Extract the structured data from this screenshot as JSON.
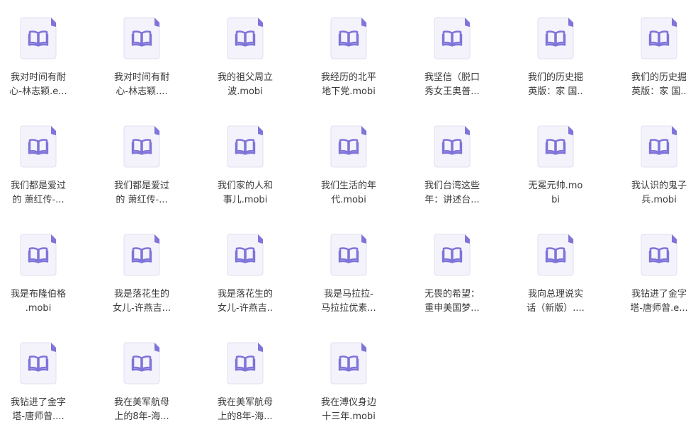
{
  "icons": {
    "file": "ebook-file-icon",
    "book": "open-book-icon"
  },
  "colors": {
    "accent": "#7f74d9",
    "page": "#f4f3fb",
    "border": "#e1dff2",
    "text": "#3a3a3a"
  },
  "files": [
    {
      "line1": "我对时间有耐",
      "line2": "心-林志颖.e..."
    },
    {
      "line1": "我对时间有耐",
      "line2": "心-林志颖...."
    },
    {
      "line1": "我的祖父周立",
      "line2": "波.mobi"
    },
    {
      "line1": "我经历的北平",
      "line2": "地下党.mobi"
    },
    {
      "line1": "我坚信（脱口",
      "line2": "秀女王奥普..."
    },
    {
      "line1": "我们的历史掘",
      "line2": "英版：家 国.."
    },
    {
      "line1": "我们的历史掘",
      "line2": "英版：家 国.."
    },
    {
      "line1": "我们都是爱过",
      "line2": "的 萧红传-..."
    },
    {
      "line1": "我们都是爱过",
      "line2": "的 萧红传-..."
    },
    {
      "line1": "我们家的人和",
      "line2": "事儿.mobi"
    },
    {
      "line1": "我们生活的年",
      "line2": "代.mobi"
    },
    {
      "line1": "我们台湾这些",
      "line2": "年：讲述台..."
    },
    {
      "line1": "无冕元帅.mo",
      "line2": "bi"
    },
    {
      "line1": "我认识的鬼子",
      "line2": "兵.mobi"
    },
    {
      "line1": "我是布隆伯格",
      "line2": ".mobi"
    },
    {
      "line1": "我是落花生的",
      "line2": "女儿-许燕吉..."
    },
    {
      "line1": "我是落花生的",
      "line2": "女儿-许燕吉.."
    },
    {
      "line1": "我是马拉拉-",
      "line2": "马拉拉优素..."
    },
    {
      "line1": "无畏的希望：",
      "line2": "重申美国梦..."
    },
    {
      "line1": "我向总理说实",
      "line2": "话（新版）...."
    },
    {
      "line1": "我钻进了金字",
      "line2": "塔-唐师曾.e..."
    },
    {
      "line1": "我钻进了金字",
      "line2": "塔-唐师曾...."
    },
    {
      "line1": "我在美军航母",
      "line2": "上的8年-海..."
    },
    {
      "line1": "我在美军航母",
      "line2": "上的8年-海..."
    },
    {
      "line1": "我在溥仪身边",
      "line2": "十三年.mobi"
    }
  ]
}
